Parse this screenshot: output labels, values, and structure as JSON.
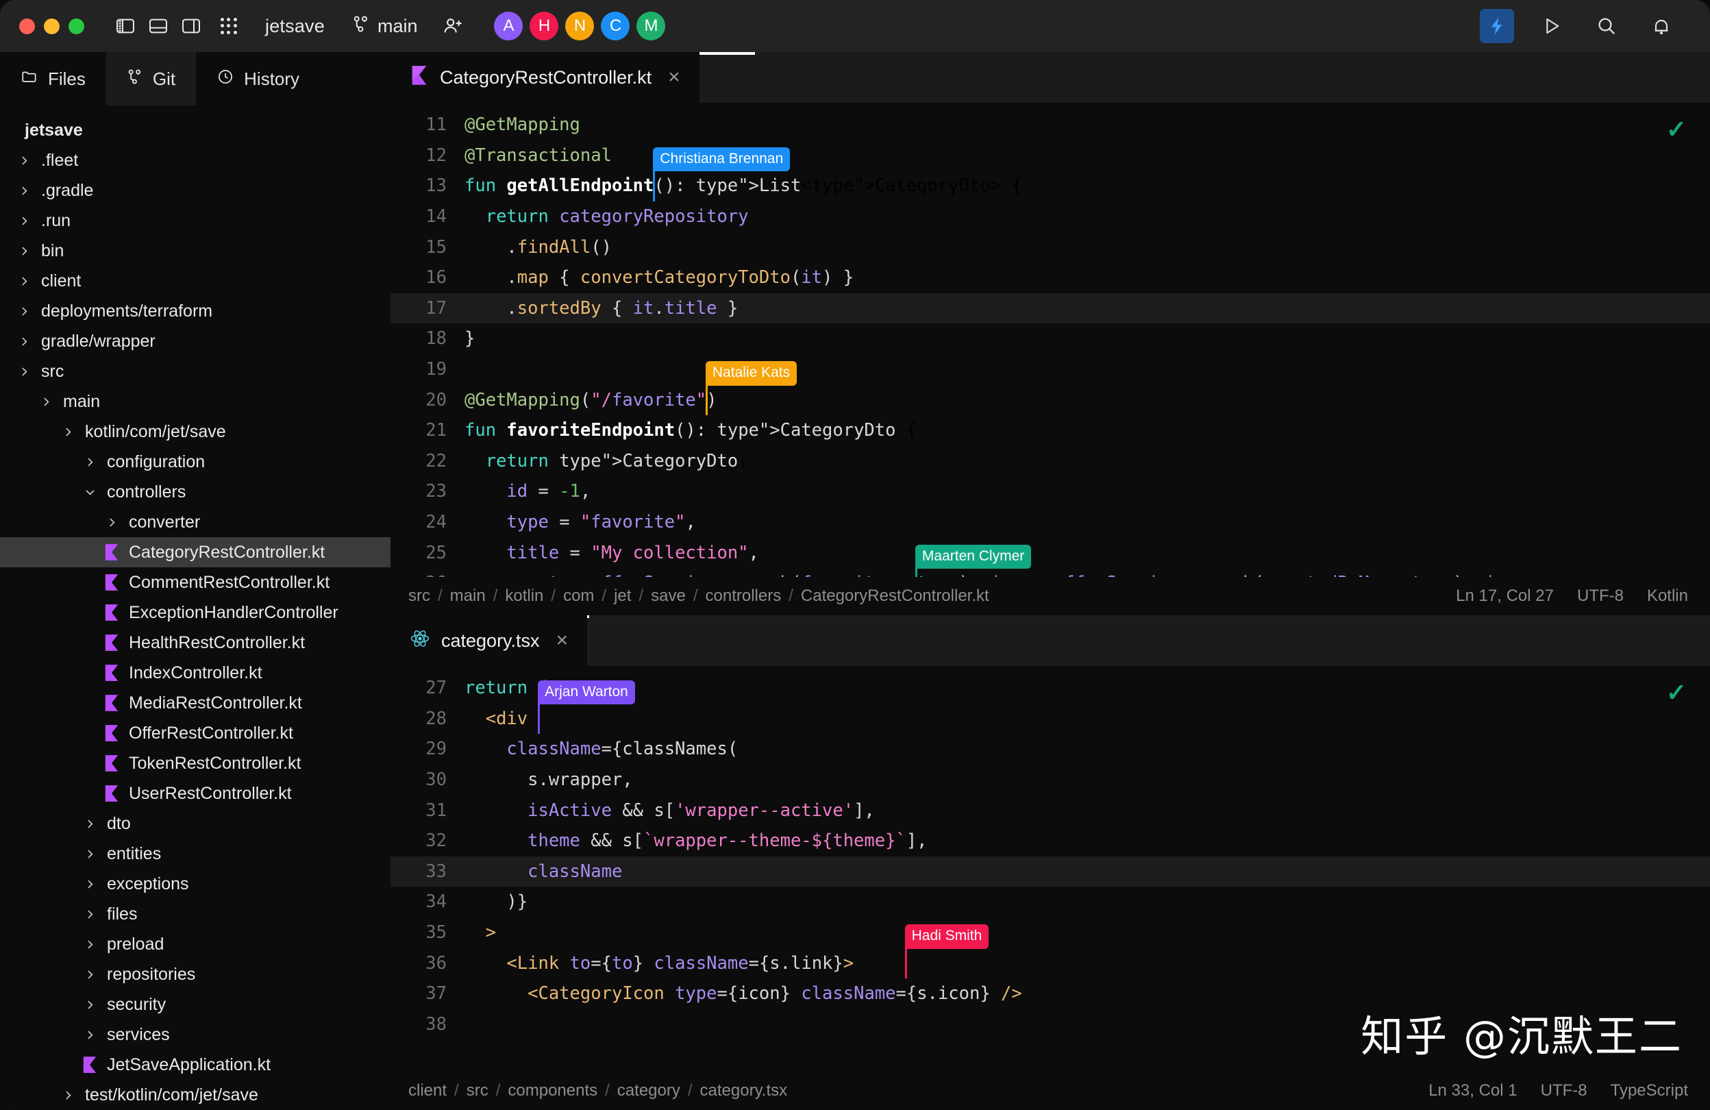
{
  "titlebar": {
    "project": "jetsave",
    "branch": "main",
    "window_controls": [
      "close",
      "minimize",
      "maximize"
    ],
    "panel_toggles": [
      "left-panel-toggle",
      "bottom-panel-toggle",
      "right-panel-toggle"
    ],
    "grid_icon": "app-grid-icon",
    "add_user_icon": "add-user-icon",
    "branch_icon": "git-branch-icon",
    "avatars": [
      {
        "initial": "A",
        "color": "#8b5cf6"
      },
      {
        "initial": "H",
        "color": "#f2194f"
      },
      {
        "initial": "N",
        "color": "#f7a50b"
      },
      {
        "initial": "C",
        "color": "#1b8ff5"
      },
      {
        "initial": "M",
        "color": "#1faf6a"
      }
    ],
    "right_icons": [
      {
        "name": "lightning-icon",
        "active": true
      },
      {
        "name": "run-icon",
        "active": false
      },
      {
        "name": "search-icon",
        "active": false
      },
      {
        "name": "notifications-bell-icon",
        "active": false
      }
    ]
  },
  "sidebar": {
    "tabs": [
      {
        "label": "Files",
        "icon": "folder-icon",
        "active": true
      },
      {
        "label": "Git",
        "icon": "git-branch-icon",
        "active": false
      },
      {
        "label": "History",
        "icon": "clock-icon",
        "active": false
      }
    ],
    "tree": [
      {
        "label": "jetsave",
        "depth": 0,
        "kind": "root",
        "chev": "",
        "bold": true,
        "sel": false
      },
      {
        "label": ".fleet",
        "depth": 0,
        "kind": "folder",
        "chev": "right",
        "bold": false,
        "sel": false
      },
      {
        "label": ".gradle",
        "depth": 0,
        "kind": "folder",
        "chev": "right",
        "bold": false,
        "sel": false
      },
      {
        "label": ".run",
        "depth": 0,
        "kind": "folder",
        "chev": "right",
        "bold": false,
        "sel": false
      },
      {
        "label": "bin",
        "depth": 0,
        "kind": "folder",
        "chev": "right",
        "bold": false,
        "sel": false
      },
      {
        "label": "client",
        "depth": 0,
        "kind": "folder",
        "chev": "right",
        "bold": false,
        "sel": false
      },
      {
        "label": "deployments/terraform",
        "depth": 0,
        "kind": "folder",
        "chev": "right",
        "bold": false,
        "sel": false
      },
      {
        "label": "gradle/wrapper",
        "depth": 0,
        "kind": "folder",
        "chev": "right",
        "bold": false,
        "sel": false
      },
      {
        "label": "src",
        "depth": 0,
        "kind": "folder",
        "chev": "right",
        "bold": false,
        "sel": false
      },
      {
        "label": "main",
        "depth": 1,
        "kind": "folder",
        "chev": "right",
        "bold": false,
        "sel": false
      },
      {
        "label": "kotlin/com/jet/save",
        "depth": 2,
        "kind": "folder",
        "chev": "right",
        "bold": false,
        "sel": false
      },
      {
        "label": "configuration",
        "depth": 3,
        "kind": "folder",
        "chev": "right",
        "bold": false,
        "sel": false
      },
      {
        "label": "controllers",
        "depth": 3,
        "kind": "folder",
        "chev": "down",
        "bold": false,
        "sel": false
      },
      {
        "label": "converter",
        "depth": 4,
        "kind": "folder",
        "chev": "right",
        "bold": false,
        "sel": false
      },
      {
        "label": "CategoryRestController.kt",
        "depth": 4,
        "kind": "kotlin",
        "chev": "",
        "bold": false,
        "sel": true
      },
      {
        "label": "CommentRestController.kt",
        "depth": 4,
        "kind": "kotlin",
        "chev": "",
        "bold": false,
        "sel": false
      },
      {
        "label": "ExceptionHandlerController",
        "depth": 4,
        "kind": "kotlin",
        "chev": "",
        "bold": false,
        "sel": false
      },
      {
        "label": "HealthRestController.kt",
        "depth": 4,
        "kind": "kotlin",
        "chev": "",
        "bold": false,
        "sel": false
      },
      {
        "label": "IndexController.kt",
        "depth": 4,
        "kind": "kotlin",
        "chev": "",
        "bold": false,
        "sel": false
      },
      {
        "label": "MediaRestController.kt",
        "depth": 4,
        "kind": "kotlin",
        "chev": "",
        "bold": false,
        "sel": false
      },
      {
        "label": "OfferRestController.kt",
        "depth": 4,
        "kind": "kotlin",
        "chev": "",
        "bold": false,
        "sel": false
      },
      {
        "label": "TokenRestController.kt",
        "depth": 4,
        "kind": "kotlin",
        "chev": "",
        "bold": false,
        "sel": false
      },
      {
        "label": "UserRestController.kt",
        "depth": 4,
        "kind": "kotlin",
        "chev": "",
        "bold": false,
        "sel": false
      },
      {
        "label": "dto",
        "depth": 3,
        "kind": "folder",
        "chev": "right",
        "bold": false,
        "sel": false
      },
      {
        "label": "entities",
        "depth": 3,
        "kind": "folder",
        "chev": "right",
        "bold": false,
        "sel": false
      },
      {
        "label": "exceptions",
        "depth": 3,
        "kind": "folder",
        "chev": "right",
        "bold": false,
        "sel": false
      },
      {
        "label": "files",
        "depth": 3,
        "kind": "folder",
        "chev": "right",
        "bold": false,
        "sel": false
      },
      {
        "label": "preload",
        "depth": 3,
        "kind": "folder",
        "chev": "right",
        "bold": false,
        "sel": false
      },
      {
        "label": "repositories",
        "depth": 3,
        "kind": "folder",
        "chev": "right",
        "bold": false,
        "sel": false
      },
      {
        "label": "security",
        "depth": 3,
        "kind": "folder",
        "chev": "right",
        "bold": false,
        "sel": false
      },
      {
        "label": "services",
        "depth": 3,
        "kind": "folder",
        "chev": "right",
        "bold": false,
        "sel": false
      },
      {
        "label": "JetSaveApplication.kt",
        "depth": 3,
        "kind": "kotlin",
        "chev": "",
        "bold": false,
        "sel": false
      },
      {
        "label": "test/kotlin/com/jet/save",
        "depth": 2,
        "kind": "folder",
        "chev": "right",
        "bold": false,
        "sel": false
      }
    ]
  },
  "editor_top": {
    "tab": {
      "label": "CategoryRestController.kt",
      "icon": "kotlin-file-icon",
      "close": "×"
    },
    "status_ok_icon": "check-icon",
    "breadcrumbs": [
      "src",
      "main",
      "kotlin",
      "com",
      "jet",
      "save",
      "controllers",
      "CategoryRestController.kt"
    ],
    "caret_position": "Ln 17, Col 27",
    "encoding": "UTF-8",
    "language": "Kotlin",
    "first_line_number": 11,
    "highlighted_line": 17,
    "lines": [
      "@GetMapping",
      "@Transactional",
      "fun getAllEndpoint(): List<CategoryDto> {",
      "  return categoryRepository",
      "    .findAll()",
      "    .map { convertCategoryToDto(it) }",
      "    .sortedBy { it.title }",
      "}",
      "",
      "@GetMapping(\"/favorite\")",
      "fun favoriteEndpoint(): CategoryDto {",
      "  return CategoryDto(",
      "    id = -1,",
      "    type = \"favorite\",",
      "    title = \"My collection\",",
      "    count = offerService.search(favorite = true).size + offerService.search(createdByMe = true).size,",
      "  )"
    ],
    "collaborators": [
      {
        "name": "Christiana Brennan",
        "color": "#1b8ff5",
        "line": 13
      },
      {
        "name": "Natalie Kats",
        "color": "#f7a50b",
        "line": 20
      },
      {
        "name": "Maarten Clymer",
        "color": "#13a884",
        "line": 26
      }
    ]
  },
  "editor_bottom": {
    "tab": {
      "label": "category.tsx",
      "icon": "react-file-icon",
      "close": "×"
    },
    "status_ok_icon": "check-icon",
    "breadcrumbs": [
      "client",
      "src",
      "components",
      "category",
      "category.tsx"
    ],
    "caret_position": "Ln 33, Col 1",
    "encoding": "UTF-8",
    "language": "TypeScript",
    "first_line_number": 27,
    "highlighted_line": 33,
    "lines": [
      "return (",
      "  <div",
      "    className={classNames(",
      "      s.wrapper,",
      "      isActive && s['wrapper--active'],",
      "      theme && s[`wrapper--theme-${theme}`],",
      "      className",
      "    )}",
      "  >",
      "    <Link to={to} className={s.link}>",
      "      <CategoryIcon type={icon} className={s.icon} />",
      ""
    ],
    "collaborators": [
      {
        "name": "Arjan Warton",
        "color": "#7b4ff5",
        "line": 28
      },
      {
        "name": "Hadi Smith",
        "color": "#f2194f",
        "line": 36
      }
    ]
  },
  "watermark": "知乎 @沉默王二"
}
